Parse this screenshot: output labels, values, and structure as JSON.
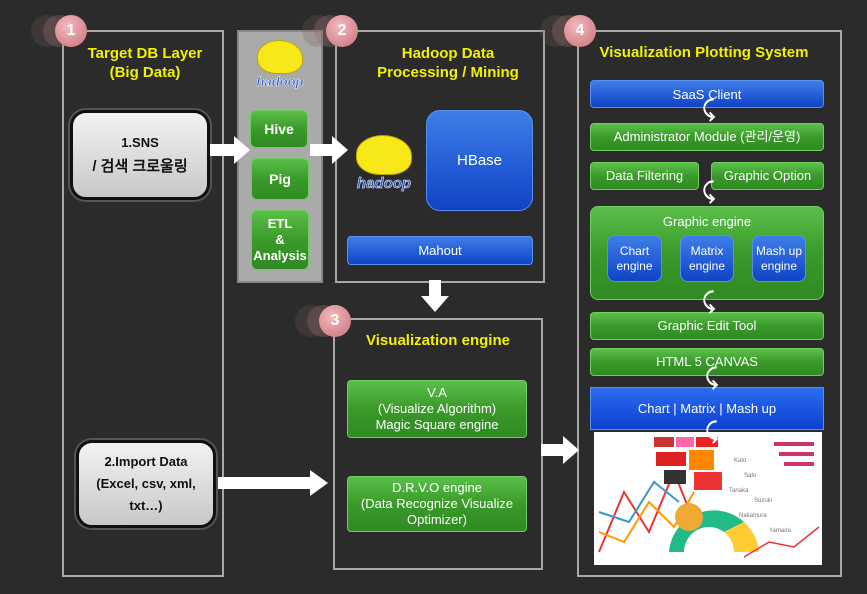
{
  "sections": {
    "s1": {
      "badge": "1",
      "title_line1": "Target DB Layer",
      "title_line2": "(Big Data)"
    },
    "s2": {
      "badge": "2",
      "title_line1": "Hadoop Data",
      "title_line2": "Processing / Mining"
    },
    "s3": {
      "badge": "3",
      "title": "Visualization engine"
    },
    "s4": {
      "badge": "4",
      "title": "Visualization Plotting System"
    }
  },
  "sources": {
    "sns_line1": "1.SNS",
    "sns_line2": "/ 검색 크로울링",
    "import_line1": "2.Import Data",
    "import_line2": "(Excel, csv, xml,",
    "import_line3": "txt…)"
  },
  "tools": {
    "logo": "hadoop",
    "hive": "Hive",
    "pig": "Pig",
    "etl_line1": "ETL",
    "etl_line2": "&",
    "etl_line3": "Analysis"
  },
  "hadoop": {
    "logo": "hadoop",
    "hbase": "HBase",
    "mahout": "Mahout"
  },
  "engine": {
    "va_line1": "V.A",
    "va_line2": "(Visualize Algorithm)",
    "va_line3": "Magic Square engine",
    "drvo_line1": "D.R.V.O engine",
    "drvo_line2": "(Data Recognize Visualize",
    "drvo_line3": "Optimizer)"
  },
  "plotting": {
    "saas": "SaaS Client",
    "admin": "Administrator Module (관리/운영)",
    "filtering": "Data Filtering",
    "option": "Graphic Option",
    "graphic_engine": "Graphic engine",
    "chart_engine_1": "Chart",
    "chart_engine_2": "engine",
    "matrix_engine_1": "Matrix",
    "matrix_engine_2": "engine",
    "mashup_engine_1": "Mash up",
    "mashup_engine_2": "engine",
    "edit_tool": "Graphic Edit Tool",
    "canvas": "HTML 5 CANVAS",
    "output": "Chart | Matrix | Mash up"
  },
  "colors": {
    "title": "#f5f000",
    "green": "#3a9a2a",
    "blue": "#2660d8",
    "background": "#2b2b2b"
  }
}
